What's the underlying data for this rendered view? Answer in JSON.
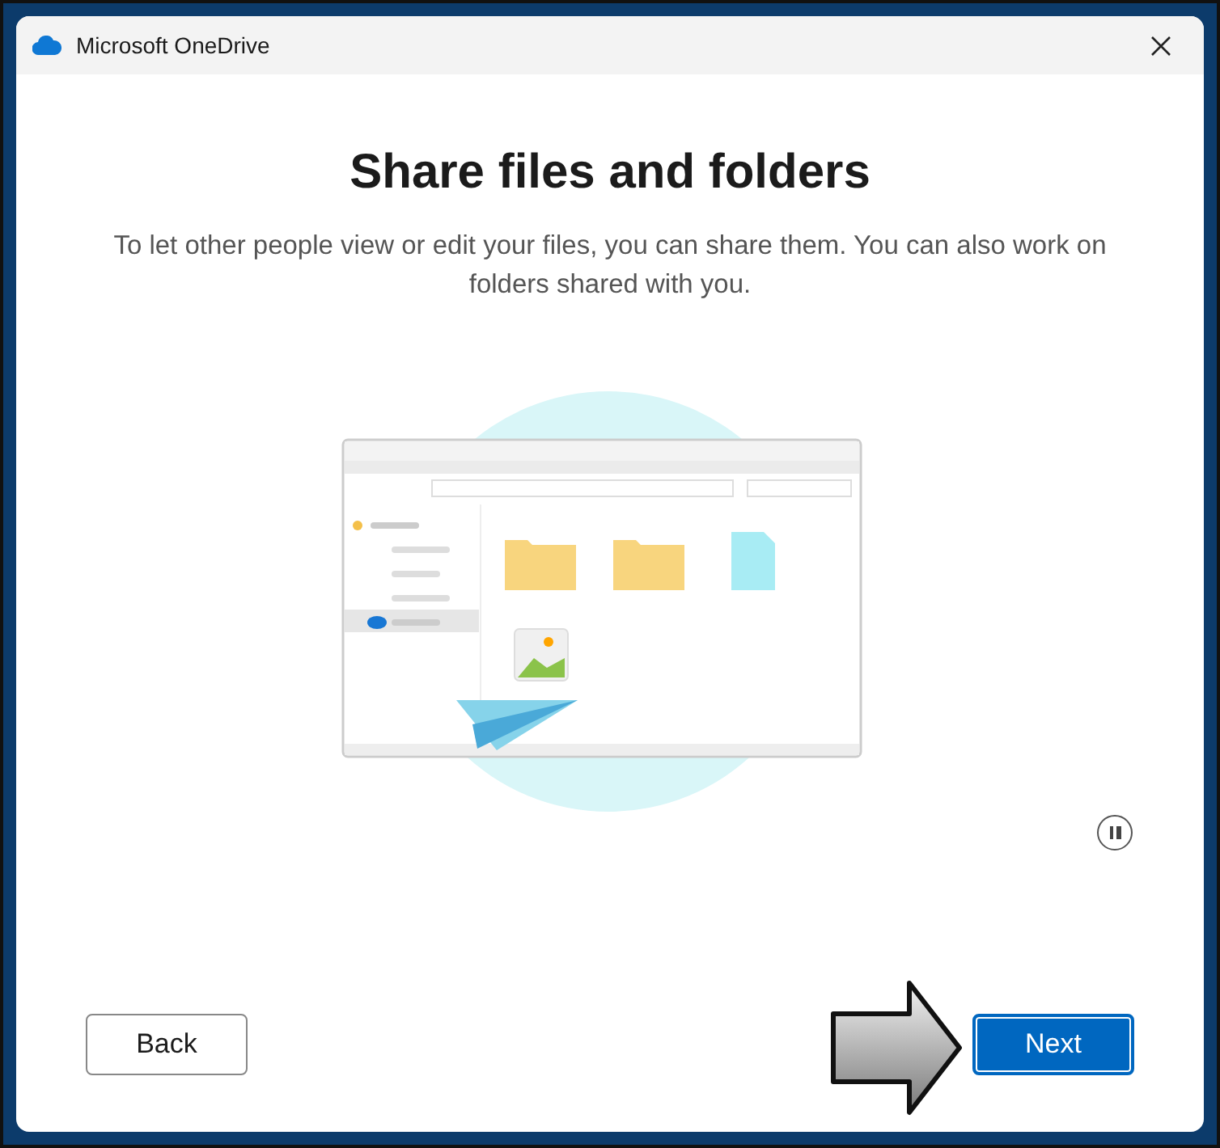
{
  "window": {
    "title": "Microsoft OneDrive"
  },
  "heading": "Share files and folders",
  "description": "To let other people view or edit your files, you can share them. You can also work on folders shared with you.",
  "media": {
    "kind": "picture",
    "playing": true
  },
  "buttons": [
    {
      "label": "Back",
      "kind": "secondary"
    },
    {
      "label": "Next",
      "kind": "primary"
    }
  ]
}
